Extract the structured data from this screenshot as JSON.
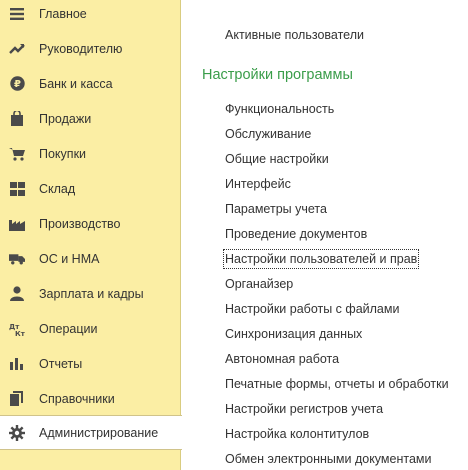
{
  "sidebar": {
    "items": [
      {
        "label": "Главное",
        "icon": "menu-icon"
      },
      {
        "label": "Руководителю",
        "icon": "chart-trend-icon"
      },
      {
        "label": "Банк и касса",
        "icon": "ruble-coin-icon"
      },
      {
        "label": "Продажи",
        "icon": "shopping-bag-icon"
      },
      {
        "label": "Покупки",
        "icon": "cart-icon"
      },
      {
        "label": "Склад",
        "icon": "warehouse-grid-icon"
      },
      {
        "label": "Производство",
        "icon": "factory-icon"
      },
      {
        "label": "ОС и НМА",
        "icon": "truck-icon"
      },
      {
        "label": "Зарплата и кадры",
        "icon": "person-icon"
      },
      {
        "label": "Операции",
        "icon": "debit-credit-icon"
      },
      {
        "label": "Отчеты",
        "icon": "bar-chart-icon"
      },
      {
        "label": "Справочники",
        "icon": "books-icon"
      },
      {
        "label": "Администрирование",
        "icon": "gear-icon"
      }
    ],
    "active_index": 12
  },
  "main": {
    "top_link": "Активные пользователи",
    "section_title": "Настройки программы",
    "links": [
      "Функциональность",
      "Обслуживание",
      "Общие настройки",
      "Интерфейс",
      "Параметры учета",
      "Проведение документов",
      "Настройки пользователей и прав",
      "Органайзер",
      "Настройки работы с файлами",
      "Синхронизация данных",
      "Автономная работа",
      "Печатные формы, отчеты и обработки",
      "Настройки регистров учета",
      "Настройка колонтитулов",
      "Обмен электронными документами"
    ],
    "focused_index": 6
  },
  "colors": {
    "sidebar_bg": "#fbeea4",
    "section_title": "#3a9d4a",
    "text": "#333333"
  }
}
